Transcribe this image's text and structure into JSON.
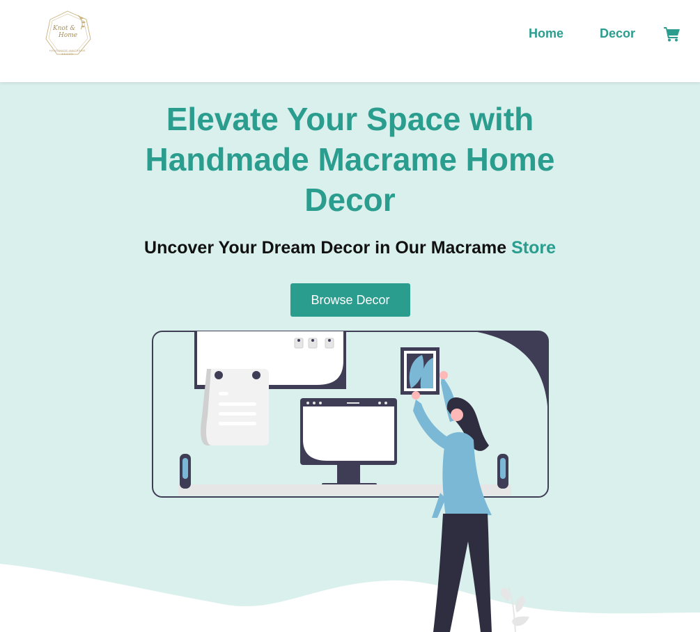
{
  "brand": {
    "logo_line1": "Knot &",
    "logo_line2": "Home",
    "logo_tagline": "HANDMADE MACRAME DECOR"
  },
  "nav": {
    "links": [
      {
        "label": "Home"
      },
      {
        "label": "Decor"
      }
    ],
    "cart_icon": "shopping-cart-icon"
  },
  "hero": {
    "title": "Elevate Your Space with Handmade Macrame Home Decor",
    "subtitle_main": "Uncover Your Dream Decor in Our Macrame ",
    "subtitle_accent": "Store",
    "cta_label": "Browse Decor"
  },
  "colors": {
    "accent": "#2a9d8f",
    "hero_bg": "#daf0ec",
    "dark": "#3f3d56",
    "figure_blue": "#7ab8d6"
  }
}
